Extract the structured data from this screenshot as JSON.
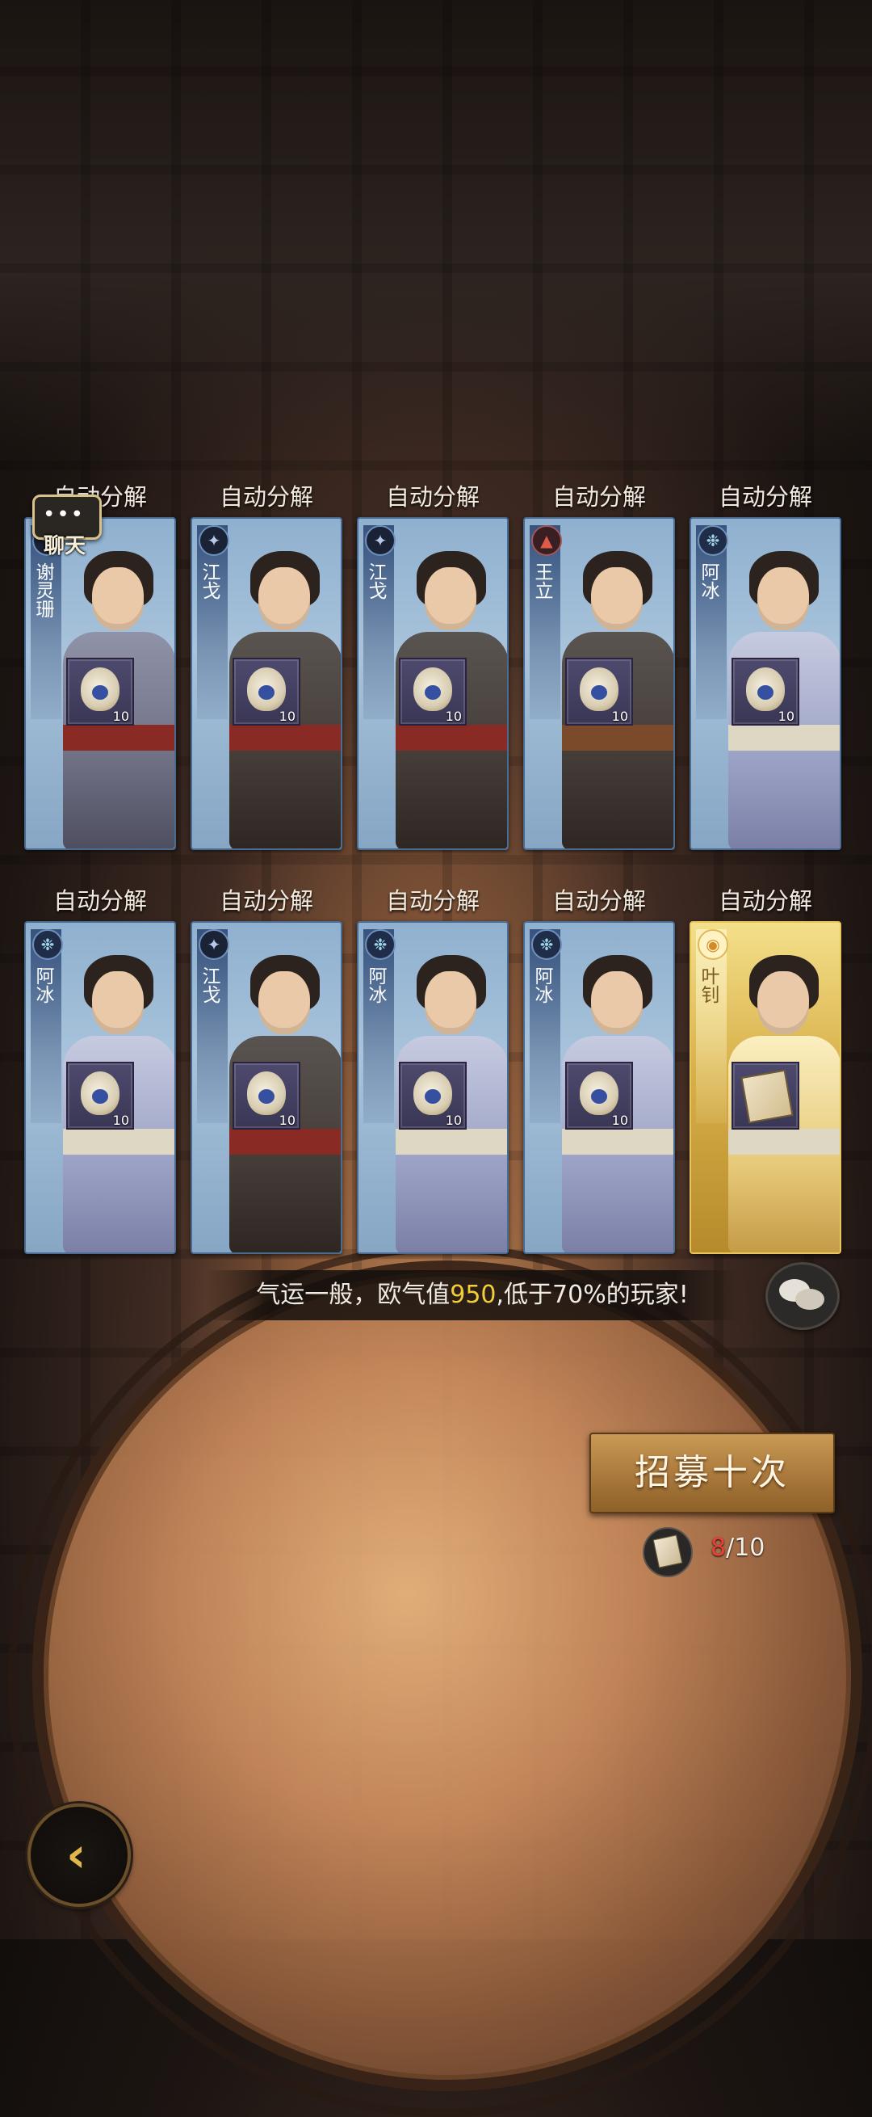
{
  "cards": [
    {
      "header": "自动分解",
      "name": "谢灵珊",
      "emblem": "✦",
      "emblem_style": "dark",
      "body": "",
      "sash": "",
      "item": "gourd",
      "count": "10",
      "gold": false
    },
    {
      "header": "自动分解",
      "name": "江戈",
      "emblem": "✦",
      "emblem_style": "dark",
      "body": "dark",
      "sash": "",
      "item": "gourd",
      "count": "10",
      "gold": false
    },
    {
      "header": "自动分解",
      "name": "江戈",
      "emblem": "✦",
      "emblem_style": "dark",
      "body": "dark",
      "sash": "",
      "item": "gourd",
      "count": "10",
      "gold": false
    },
    {
      "header": "自动分解",
      "name": "王立",
      "emblem": "▲",
      "emblem_style": "red",
      "body": "dark",
      "sash": "brown",
      "item": "gourd",
      "count": "10",
      "gold": false
    },
    {
      "header": "自动分解",
      "name": "阿冰",
      "emblem": "❉",
      "emblem_style": "",
      "body": "light",
      "sash": "white",
      "item": "gourd",
      "count": "10",
      "gold": false
    },
    {
      "header": "自动分解",
      "name": "阿冰",
      "emblem": "❉",
      "emblem_style": "",
      "body": "light",
      "sash": "white",
      "item": "gourd",
      "count": "10",
      "gold": false
    },
    {
      "header": "自动分解",
      "name": "江戈",
      "emblem": "✦",
      "emblem_style": "dark",
      "body": "dark",
      "sash": "",
      "item": "gourd",
      "count": "10",
      "gold": false
    },
    {
      "header": "自动分解",
      "name": "阿冰",
      "emblem": "❉",
      "emblem_style": "",
      "body": "light",
      "sash": "white",
      "item": "gourd",
      "count": "10",
      "gold": false
    },
    {
      "header": "自动分解",
      "name": "阿冰",
      "emblem": "❉",
      "emblem_style": "",
      "body": "light",
      "sash": "white",
      "item": "gourd",
      "count": "10",
      "gold": false
    },
    {
      "header": "自动分解",
      "name": "叶钊",
      "emblem": "◉",
      "emblem_style": "",
      "body": "gold",
      "sash": "white",
      "item": "scroll",
      "count": "",
      "gold": true
    }
  ],
  "chat": {
    "dots": "•••",
    "label": "聊天"
  },
  "luck": {
    "prefix": "气运一般，欧气值",
    "value": "950",
    "suffix": ",低于70%的玩家!"
  },
  "recruit": {
    "label": "招募十次"
  },
  "ticket": {
    "current": "8",
    "total": "/10"
  },
  "back": {
    "icon": "‹"
  }
}
